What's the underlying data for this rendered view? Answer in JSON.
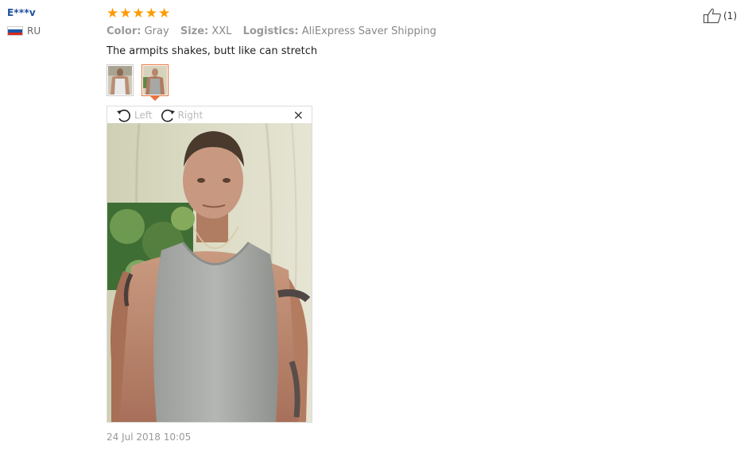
{
  "user": {
    "name": "E***v",
    "country": "RU",
    "flag_colors": [
      "#ffffff",
      "#1c57a5",
      "#d52b1e"
    ]
  },
  "review": {
    "rating": 5,
    "star_color": "#ff9a00",
    "attributes": [
      {
        "label": "Color:",
        "value": "Gray"
      },
      {
        "label": "Size:",
        "value": "XXL"
      },
      {
        "label": "Logistics:",
        "value": "AliExpress Saver Shipping"
      }
    ],
    "text": "The armpits shakes, butt like can stretch",
    "thumbnails": [
      {
        "name": "photo-1"
      },
      {
        "name": "photo-2",
        "active": true
      }
    ],
    "viewer": {
      "rotate_left": "Left",
      "rotate_right": "Right",
      "close": "×"
    },
    "date": "24 Jul 2018 10:05"
  },
  "helpful": {
    "count": "(1)",
    "icon": "thumbs-up-icon"
  }
}
